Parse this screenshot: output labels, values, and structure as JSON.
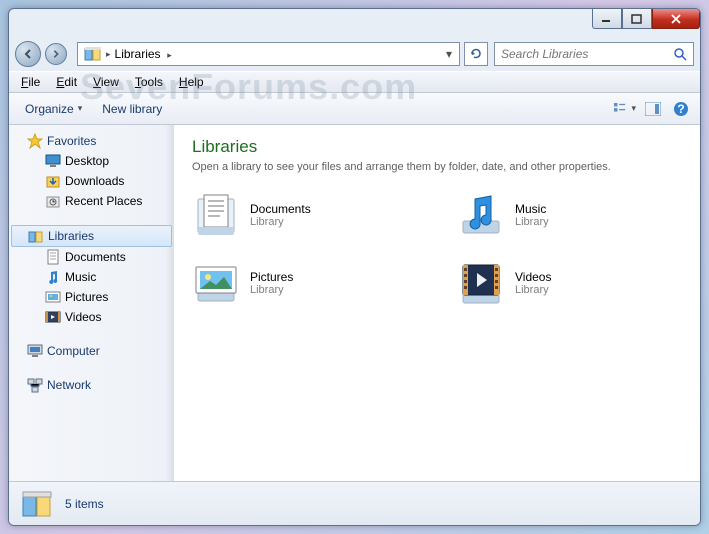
{
  "window": {
    "min_tip": "Minimize",
    "max_tip": "Maximize",
    "close_tip": "Close"
  },
  "nav": {
    "back_tip": "Back",
    "fwd_tip": "Forward",
    "path_root": "Libraries",
    "path_sep": "›",
    "refresh_tip": "Refresh"
  },
  "search": {
    "placeholder": "Search Libraries"
  },
  "menu": {
    "file": "File",
    "edit": "Edit",
    "view": "View",
    "tools": "Tools",
    "help": "Help"
  },
  "toolbar": {
    "organize": "Organize",
    "newlib": "New library",
    "viewmode_tip": "Change your view",
    "preview_tip": "Show the preview pane",
    "help_tip": "Get help"
  },
  "sidebar": {
    "favorites": "Favorites",
    "fav_items": [
      {
        "label": "Desktop"
      },
      {
        "label": "Downloads"
      },
      {
        "label": "Recent Places"
      }
    ],
    "libraries": "Libraries",
    "lib_items": [
      {
        "label": "Documents"
      },
      {
        "label": "Music"
      },
      {
        "label": "Pictures"
      },
      {
        "label": "Videos"
      }
    ],
    "computer": "Computer",
    "network": "Network"
  },
  "content": {
    "heading": "Libraries",
    "subtitle": "Open a library to see your files and arrange them by folder, date, and other properties.",
    "items": [
      {
        "name": "Documents",
        "type": "Library"
      },
      {
        "name": "Music",
        "type": "Library"
      },
      {
        "name": "Pictures",
        "type": "Library"
      },
      {
        "name": "Videos",
        "type": "Library"
      }
    ]
  },
  "status": {
    "text": "5 items"
  },
  "watermark": "SevenForums.com"
}
